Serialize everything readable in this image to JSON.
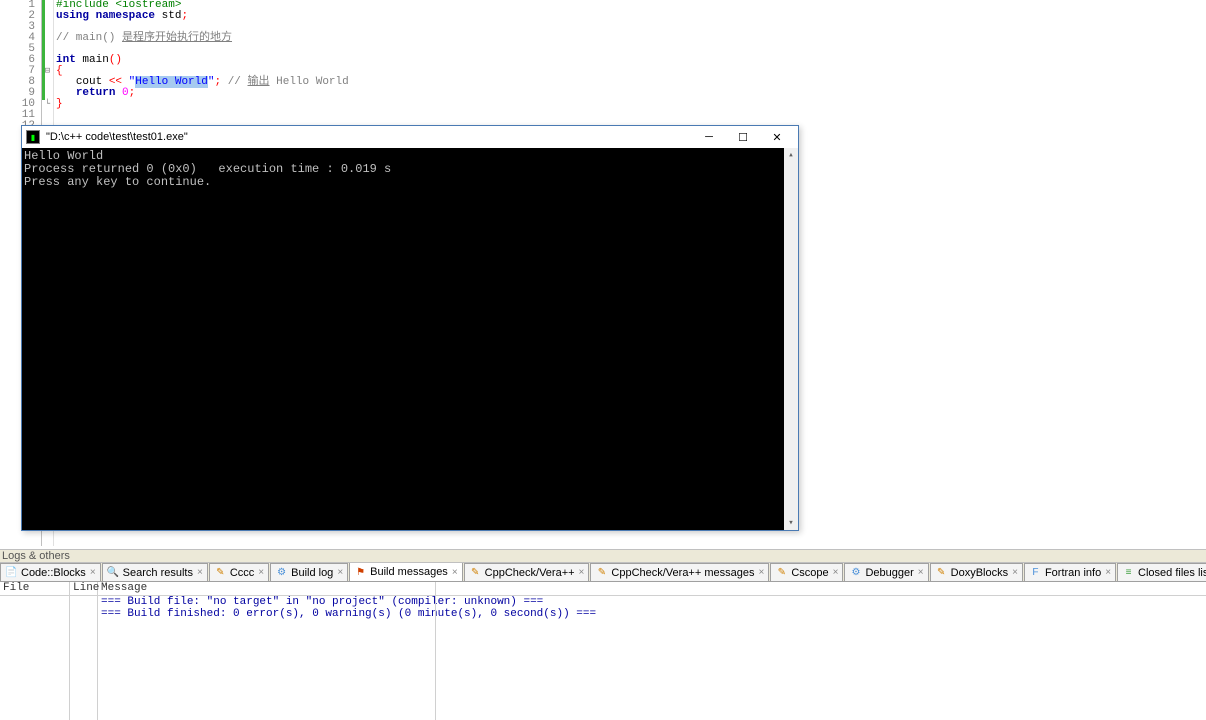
{
  "editor": {
    "lines": [
      {
        "n": 1,
        "segs": [
          {
            "cls": "kw-pre",
            "t": "#include "
          },
          {
            "cls": "kw-pre",
            "t": "<iostream>"
          }
        ]
      },
      {
        "n": 2,
        "segs": [
          {
            "cls": "kw",
            "t": "using namespace "
          },
          {
            "cls": "ident",
            "t": "std"
          },
          {
            "cls": "op",
            "t": ";"
          }
        ]
      },
      {
        "n": 3,
        "segs": []
      },
      {
        "n": 4,
        "segs": [
          {
            "cls": "comment",
            "t": "// main() "
          },
          {
            "cls": "comment",
            "u": true,
            "t": "是程序开始执行的地方"
          }
        ]
      },
      {
        "n": 5,
        "segs": []
      },
      {
        "n": 6,
        "segs": [
          {
            "cls": "kw",
            "t": "int "
          },
          {
            "cls": "fnname",
            "t": "main"
          },
          {
            "cls": "op",
            "t": "()"
          }
        ]
      },
      {
        "n": 7,
        "fold": "⊟",
        "segs": [
          {
            "cls": "brace",
            "t": "{"
          }
        ]
      },
      {
        "n": 8,
        "segs": [
          {
            "cls": "",
            "t": "   "
          },
          {
            "cls": "ident",
            "t": "cout"
          },
          {
            "cls": "",
            "t": " "
          },
          {
            "cls": "op",
            "t": "<<"
          },
          {
            "cls": "",
            "t": " "
          },
          {
            "cls": "str",
            "t": "\""
          },
          {
            "cls": "str sel",
            "t": "Hello World"
          },
          {
            "cls": "str",
            "t": "\""
          },
          {
            "cls": "op",
            "t": ";"
          },
          {
            "cls": "",
            "t": " "
          },
          {
            "cls": "comment",
            "t": "// "
          },
          {
            "cls": "comment",
            "u": true,
            "t": "输出"
          },
          {
            "cls": "comment",
            "t": " Hello World"
          }
        ]
      },
      {
        "n": 9,
        "segs": [
          {
            "cls": "",
            "t": "   "
          },
          {
            "cls": "kw",
            "t": "return "
          },
          {
            "cls": "num",
            "t": "0"
          },
          {
            "cls": "op",
            "t": ";"
          }
        ]
      },
      {
        "n": 10,
        "fold": "└",
        "segs": [
          {
            "cls": "brace",
            "t": "}"
          }
        ]
      },
      {
        "n": 11,
        "segs": []
      },
      {
        "n": 12,
        "segs": []
      }
    ]
  },
  "console": {
    "title": "\"D:\\c++ code\\test\\test01.exe\"",
    "lines": [
      "Hello World",
      "Process returned 0 (0x0)   execution time : 0.019 s",
      "Press any key to continue."
    ]
  },
  "logs_title": "Logs & others",
  "tabs": [
    {
      "icon": "📄",
      "color": "#d0a000",
      "label": "Code::Blocks"
    },
    {
      "icon": "🔍",
      "color": "#4a90d9",
      "label": "Search results"
    },
    {
      "icon": "✎",
      "color": "#d08000",
      "label": "Cccc"
    },
    {
      "icon": "⚙",
      "color": "#4a90d9",
      "label": "Build log"
    },
    {
      "icon": "⚑",
      "color": "#d04000",
      "label": "Build messages",
      "active": true
    },
    {
      "icon": "✎",
      "color": "#d08000",
      "label": "CppCheck/Vera++"
    },
    {
      "icon": "✎",
      "color": "#d08000",
      "label": "CppCheck/Vera++ messages"
    },
    {
      "icon": "✎",
      "color": "#d08000",
      "label": "Cscope"
    },
    {
      "icon": "⚙",
      "color": "#4a90d9",
      "label": "Debugger"
    },
    {
      "icon": "✎",
      "color": "#d08000",
      "label": "DoxyBlocks"
    },
    {
      "icon": "F",
      "color": "#4a90d9",
      "label": "Fortran info"
    },
    {
      "icon": "≡",
      "color": "#40a040",
      "label": "Closed files list"
    }
  ],
  "msg_headers": {
    "file": "File",
    "line": "Line",
    "msg": "Message"
  },
  "messages": [
    "=== Build file: \"no target\" in \"no project\" (compiler: unknown) ===",
    "=== Build finished: 0 error(s), 0 warning(s) (0 minute(s), 0 second(s)) ==="
  ]
}
